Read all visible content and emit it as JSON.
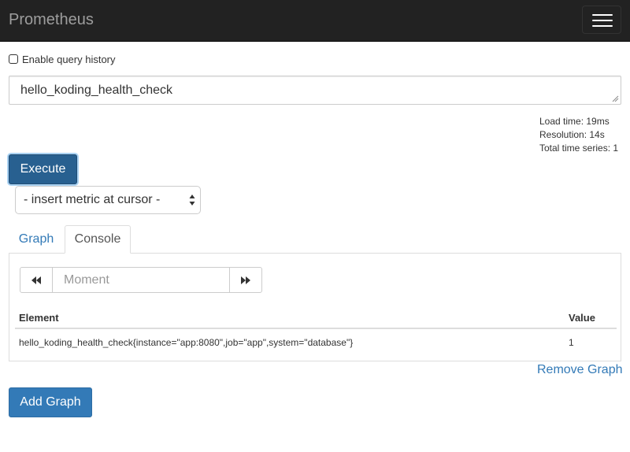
{
  "navbar": {
    "brand": "Prometheus",
    "menu_icon": "hamburger-icon"
  },
  "query_history": {
    "label": "Enable query history",
    "checked": false
  },
  "expression": {
    "value": "hello_koding_health_check"
  },
  "stats": {
    "load_time": "Load time: 19ms",
    "resolution": "Resolution: 14s",
    "total_series": "Total time series: 1"
  },
  "execute_label": "Execute",
  "metric_select": {
    "selected": "- insert metric at cursor -"
  },
  "tabs": {
    "graph": "Graph",
    "console": "Console",
    "active": "Console"
  },
  "console": {
    "moment_placeholder": "Moment",
    "back_icon": "backward-icon",
    "forward_icon": "forward-icon",
    "columns": {
      "element": "Element",
      "value": "Value"
    },
    "rows": [
      {
        "element": "hello_koding_health_check{instance=\"app:8080\",job=\"app\",system=\"database\"}",
        "value": "1"
      }
    ]
  },
  "remove_graph_label": "Remove Graph",
  "add_graph_label": "Add Graph",
  "colors": {
    "navbar_bg": "#222222",
    "brand_text": "#9d9d9d",
    "primary": "#337ab7",
    "primary_dark": "#286090",
    "link": "#337ab7"
  }
}
